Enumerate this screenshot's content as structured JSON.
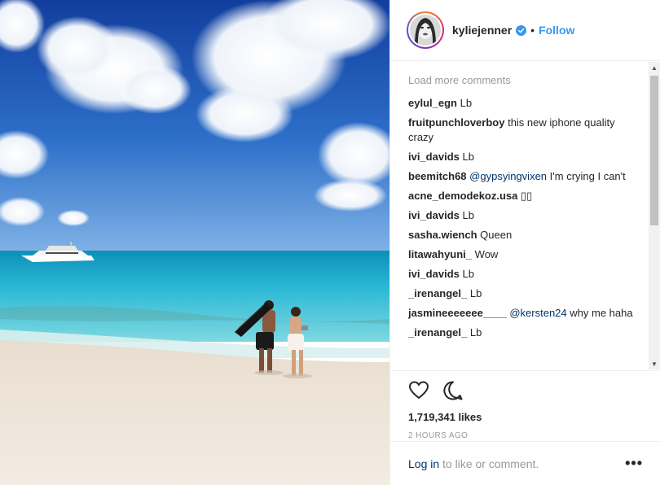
{
  "post": {
    "username": "kyliejenner",
    "verified": true,
    "follow_label": "Follow",
    "separator": "•"
  },
  "comments": {
    "load_more": "Load more comments",
    "items": [
      {
        "user": "eylul_egn",
        "text": "Lb",
        "mention": ""
      },
      {
        "user": "fruitpunchloverboy",
        "text": "this new iphone quality crazy",
        "mention": ""
      },
      {
        "user": "ivi_davids",
        "text": "Lb",
        "mention": ""
      },
      {
        "user": "beemitch68",
        "mention": "@gypsyingvixen",
        "text": "I'm crying I can't"
      },
      {
        "user": "acne_demodekoz.usa",
        "text": "▯▯",
        "mention": ""
      },
      {
        "user": "ivi_davids",
        "text": "Lb",
        "mention": ""
      },
      {
        "user": "sasha.wiench",
        "text": "Queen",
        "mention": ""
      },
      {
        "user": "litawahyuni_",
        "text": "Wow",
        "mention": ""
      },
      {
        "user": "ivi_davids",
        "text": "Lb",
        "mention": ""
      },
      {
        "user": "_irenangel_",
        "text": "Lb",
        "mention": ""
      },
      {
        "user": "jasmineeeeeee____",
        "mention": "@kersten24",
        "text": "why me haha"
      },
      {
        "user": "_irenangel_",
        "text": "Lb",
        "mention": ""
      }
    ]
  },
  "actions": {
    "like_icon": "heart-icon",
    "comment_icon": "comment-icon",
    "likes": "1,719,341 likes",
    "time": "2 HOURS AGO"
  },
  "footer": {
    "login_label": "Log in",
    "rest": "to like or comment.",
    "more_icon": "•••"
  },
  "colors": {
    "accent": "#3897f0",
    "link": "#003569",
    "muted": "#999999",
    "text": "#262626"
  }
}
